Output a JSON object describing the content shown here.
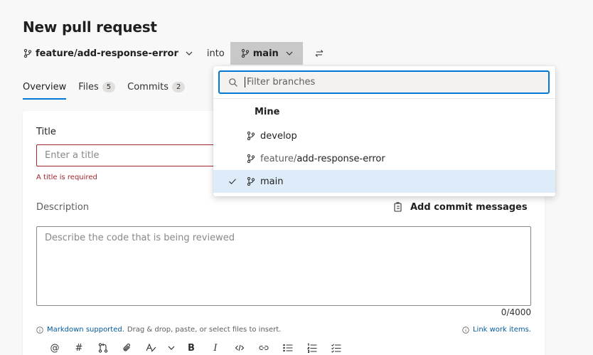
{
  "header": {
    "title": "New pull request",
    "source_branch": "feature/add-response-error",
    "into_label": "into",
    "target_branch": "main"
  },
  "tabs": [
    {
      "label": "Overview",
      "count": null,
      "active": true
    },
    {
      "label": "Files",
      "count": "5",
      "active": false
    },
    {
      "label": "Commits",
      "count": "2",
      "active": false
    }
  ],
  "form": {
    "title_label": "Title",
    "title_placeholder": "Enter a title",
    "title_error": "A title is required",
    "description_label": "Description",
    "add_commit_messages": "Add commit messages",
    "description_placeholder": "Describe the code that is being reviewed",
    "char_counter": "0/4000",
    "hint_link": "Markdown supported.",
    "hint_text": "Drag & drop, paste, or select files to insert.",
    "link_work_items": "Link work items."
  },
  "branch_dropdown": {
    "filter_placeholder": "Filter branches",
    "group_header": "Mine",
    "branches": [
      {
        "prefix": "",
        "name": "develop",
        "selected": false
      },
      {
        "prefix": "feature/",
        "name": "add-response-error",
        "selected": false
      },
      {
        "prefix": "",
        "name": "main",
        "selected": true
      }
    ]
  },
  "toolbar_icons": [
    "mention-icon",
    "hashtag-icon",
    "pull-request-icon",
    "attach-icon",
    "text-style-icon",
    "chevron-down-icon",
    "bold-icon",
    "italic-icon",
    "code-icon",
    "link-icon",
    "bullet-list-icon",
    "numbered-list-icon",
    "task-list-icon"
  ],
  "colors": {
    "accent": "#0078d4",
    "error": "#a4262c",
    "selected_row": "#deecf9",
    "link": "#005a9e"
  }
}
